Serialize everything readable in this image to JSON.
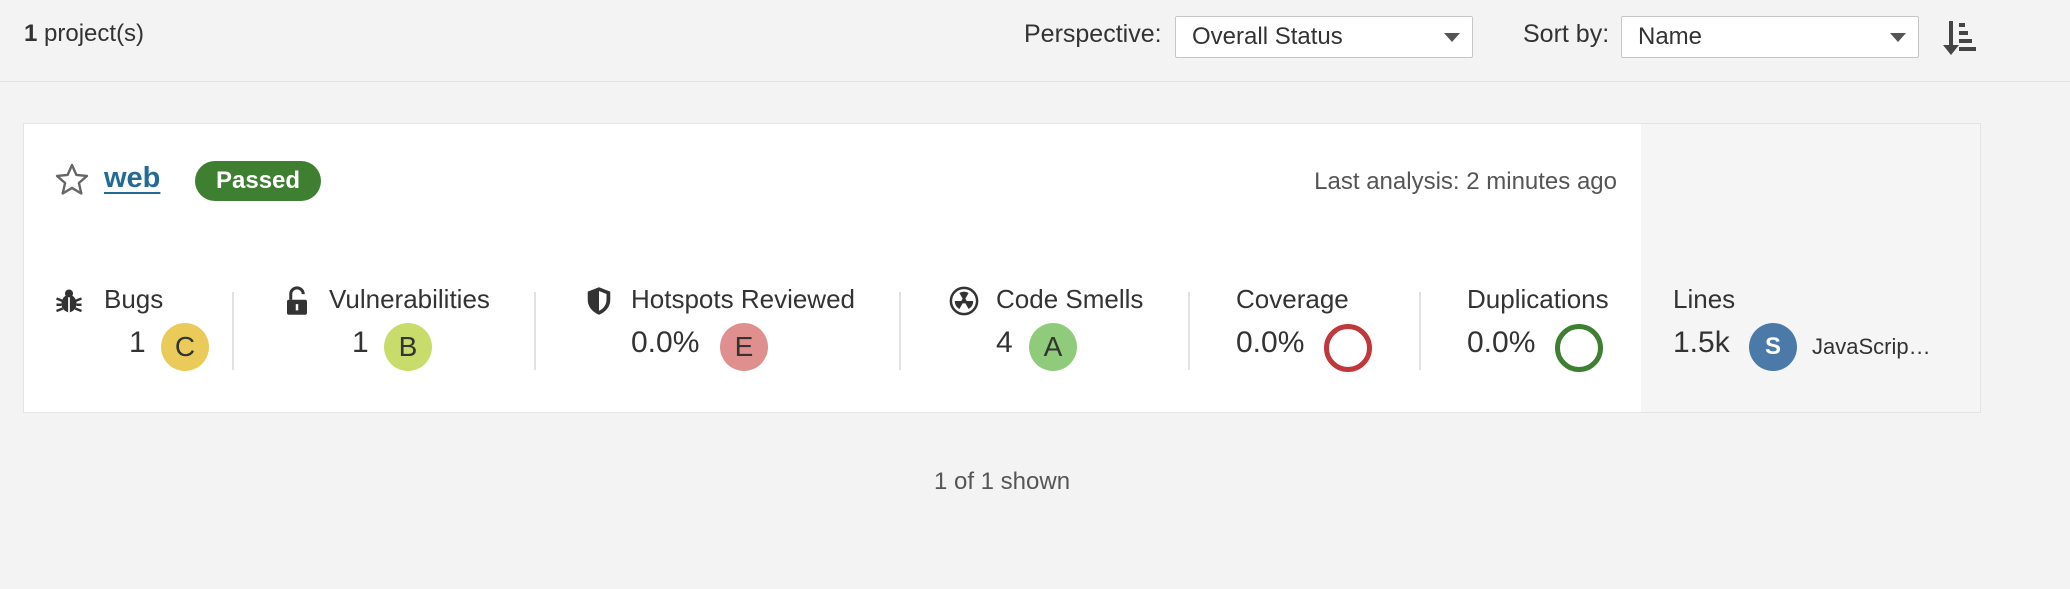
{
  "header": {
    "project_count": "1",
    "project_count_suffix": " project(s)",
    "perspective_label": "Perspective:",
    "perspective_value": "Overall Status",
    "sort_label": "Sort by:",
    "sort_value": "Name",
    "sort_icon": "sort-descending-icon"
  },
  "project": {
    "name": "web",
    "status": "Passed",
    "status_color": "#3e7f32",
    "last_analysis": "Last analysis: 2 minutes ago",
    "metrics": {
      "bugs": {
        "label": "Bugs",
        "value": "1",
        "rating": "C",
        "rating_color": "#eacb5a"
      },
      "vulnerabilities": {
        "label": "Vulnerabilities",
        "value": "1",
        "rating": "B",
        "rating_color": "#c8dc6b"
      },
      "hotspots": {
        "label": "Hotspots Reviewed",
        "value": "0.0%",
        "rating": "E",
        "rating_color": "#e08f8f"
      },
      "code_smells": {
        "label": "Code Smells",
        "value": "4",
        "rating": "A",
        "rating_color": "#8fcb7a"
      },
      "coverage": {
        "label": "Coverage",
        "value": "0.0%",
        "ring_color": "#c0373c"
      },
      "duplications": {
        "label": "Duplications",
        "value": "0.0%",
        "ring_color": "#3e7f32"
      },
      "lines": {
        "label": "Lines",
        "value": "1.5k",
        "language_initial": "S",
        "language": "JavaScrip…",
        "avatar_color": "#4b79a8"
      }
    }
  },
  "footer": {
    "shown": "1 of 1 shown"
  }
}
